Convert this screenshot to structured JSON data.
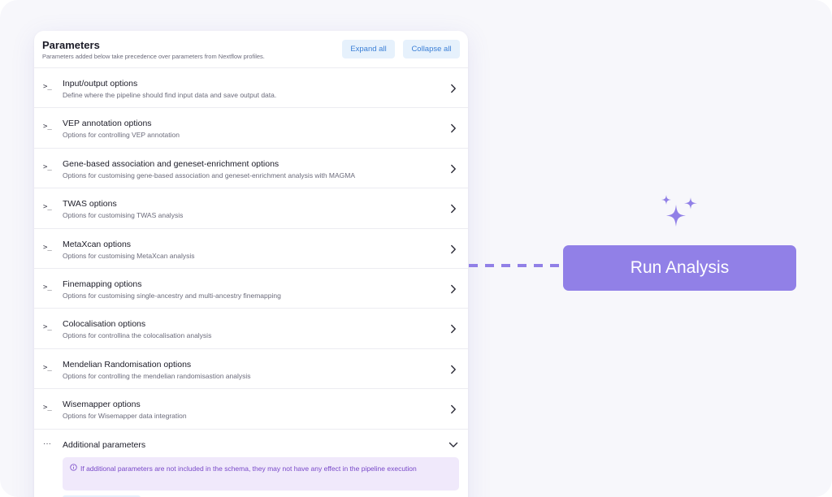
{
  "panel": {
    "title": "Parameters",
    "subtitle": "Parameters added below take precedence over parameters from Nextflow profiles.",
    "expand_label": "Expand all",
    "collapse_label": "Collapse all"
  },
  "sections": [
    {
      "title": "Input/output options",
      "description": "Define where the pipeline should find input data and save output data."
    },
    {
      "title": "VEP annotation options",
      "description": "Options for controlling VEP annotation"
    },
    {
      "title": "Gene-based association and geneset-enrichment options",
      "description": "Options for customising gene-based association and geneset-enrichment analysis with MAGMA"
    },
    {
      "title": "TWAS options",
      "description": "Options for customising TWAS analysis"
    },
    {
      "title": "MetaXcan options",
      "description": "Options for customising MetaXcan analysis"
    },
    {
      "title": "Finemapping options",
      "description": "Options for customising single-ancestry and multi-ancestry finemapping"
    },
    {
      "title": "Colocalisation options",
      "description": "Options for controllina the colocalisation analysis"
    },
    {
      "title": "Mendelian Randomisation options",
      "description": "Options for controlling the mendelian randomisastion analysis"
    },
    {
      "title": "Wisemapper options",
      "description": "Options for Wisemapper data integration"
    }
  ],
  "additional": {
    "title": "Additional parameters",
    "notice": "If additional parameters are not included in the schema, they may not have any effect in the pipeline execution"
  },
  "run": {
    "label": "Run Analysis"
  },
  "icons": {
    "section_icon": "terminal-prompt-icon",
    "row_chevron": "chevron-right-icon",
    "additional_icon": "ellipsis-icon",
    "additional_chevron": "chevron-down-icon",
    "notice_icon": "info-icon",
    "sparkle": "sparkles-icon"
  },
  "colors": {
    "accent": "#9180e7",
    "button_bg": "#e6f1fc",
    "button_text": "#3b7fd6",
    "notice_bg": "#f0e9fb",
    "notice_text": "#7848c8"
  }
}
